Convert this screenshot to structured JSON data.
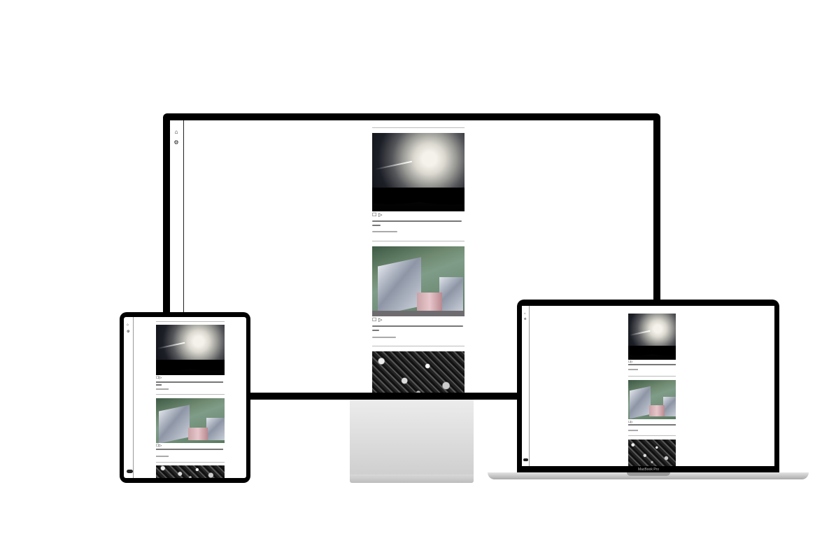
{
  "devices": {
    "desktop": {
      "label": ""
    },
    "tablet": {
      "label": ""
    },
    "laptop": {
      "label": "MacBook Pro"
    }
  },
  "sidebar": {
    "icons": [
      "home-icon",
      "gear-icon"
    ],
    "toggle": "toggle-icon"
  },
  "posts": [
    {
      "image": "moon-night-sky",
      "actions": [
        "comment-icon",
        "share-icon"
      ]
    },
    {
      "image": "star-trail-wall",
      "actions": [
        "comment-icon",
        "share-icon"
      ]
    },
    {
      "image": "rocky-ground",
      "actions": []
    }
  ],
  "colors": {
    "bezel": "#000000",
    "screen": "#ffffff",
    "divider": "#bbbbbb"
  }
}
